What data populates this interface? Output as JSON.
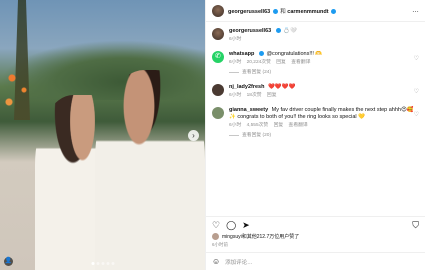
{
  "photo": {
    "next_arrow": "›",
    "dot_count": 5,
    "active_dot": 0
  },
  "header": {
    "user1": "georgerussell63",
    "and": "和",
    "user2": "carmenmmundt",
    "more": "…"
  },
  "caption": {
    "user": "georgerussell63",
    "text": "💍🤍",
    "time": "6小时"
  },
  "comments": [
    {
      "user": "whatsapp",
      "text": "@congratulations!!! 🫶",
      "time": "6小时",
      "likes": "20,224次赞",
      "reply": "回复",
      "extra": "查看翻译",
      "replies": "查看回复 (24)",
      "avatar_color": "#25d366",
      "is_whatsapp": true
    },
    {
      "user": "nj_lady2fresh",
      "text": "❤️❤️❤️❤️",
      "time": "6小时",
      "likes": "18次赞",
      "reply": "回复",
      "extra": "",
      "replies": "",
      "avatar_color": "#4a3a32",
      "is_whatsapp": false
    },
    {
      "user": "gianna_sweety",
      "text": "My fav driver couple finally makes the next step ahhh😍🥰✨ congrats to both of you!! the ring looks so special 💛",
      "time": "6小时",
      "likes": "4,555次赞",
      "reply": "回复",
      "extra": "查看翻译",
      "replies": "查看回复 (20)",
      "avatar_color": "#7a8f6a",
      "is_whatsapp": false
    }
  ],
  "actions": {
    "like_icon": "heart-icon",
    "comment_icon": "comment-icon",
    "share_icon": "share-icon",
    "save_icon": "bookmark-icon"
  },
  "likes": {
    "text": "mingsuyi和其他212.7万位用户赞了"
  },
  "date": "6小时前",
  "add_comment": {
    "placeholder": "添加评论…"
  }
}
